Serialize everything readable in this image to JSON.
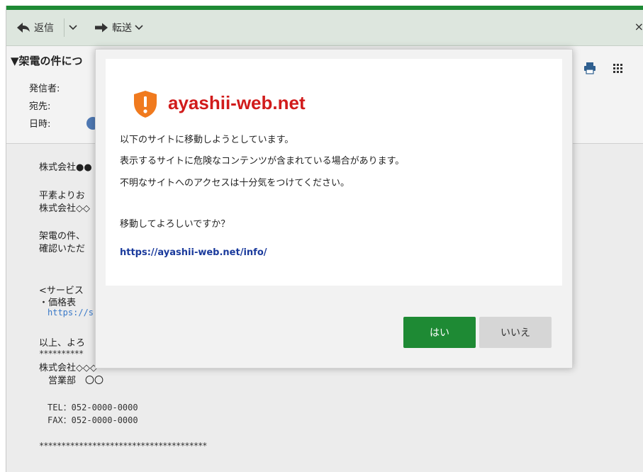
{
  "toolbar": {
    "reply_label": "返信",
    "forward_label": "転送",
    "close_glyph": "×",
    "accent_color": "#1e8a34"
  },
  "mail": {
    "subject": "▼架電の件につ",
    "from_label": "発信者:",
    "to_label": "宛先:",
    "date_label": "日時:",
    "body": {
      "line1": "株式会社●●",
      "line2": "平素よりお",
      "line3": "株式会社◇◇",
      "line4": "架電の件、",
      "line5": "確認いただ",
      "line6": "<サービス",
      "line7": "・価格表",
      "link": "https://s",
      "line8": "以上、よろ",
      "stars1": "**********",
      "company": "株式会社◇◇◇",
      "dept": "　営業部　〇〇",
      "tel": "TEL：052-0000-0000",
      "fax": "FAX：052-0000-0000",
      "stars2": "**************************************"
    }
  },
  "dialog": {
    "domain": "ayashii-web.net",
    "message1": "以下のサイトに移動しようとしています。",
    "message2": "表示するサイトに危険なコンテンツが含まれている場合があります。",
    "message3": "不明なサイトへのアクセスは十分気をつけてください。",
    "question": "移動してよろしいですか？",
    "url": "https://ayashii-web.net/info/",
    "yes_label": "はい",
    "no_label": "いいえ",
    "warning_color": "#d11b1b",
    "shield_color": "#f07a1e"
  }
}
